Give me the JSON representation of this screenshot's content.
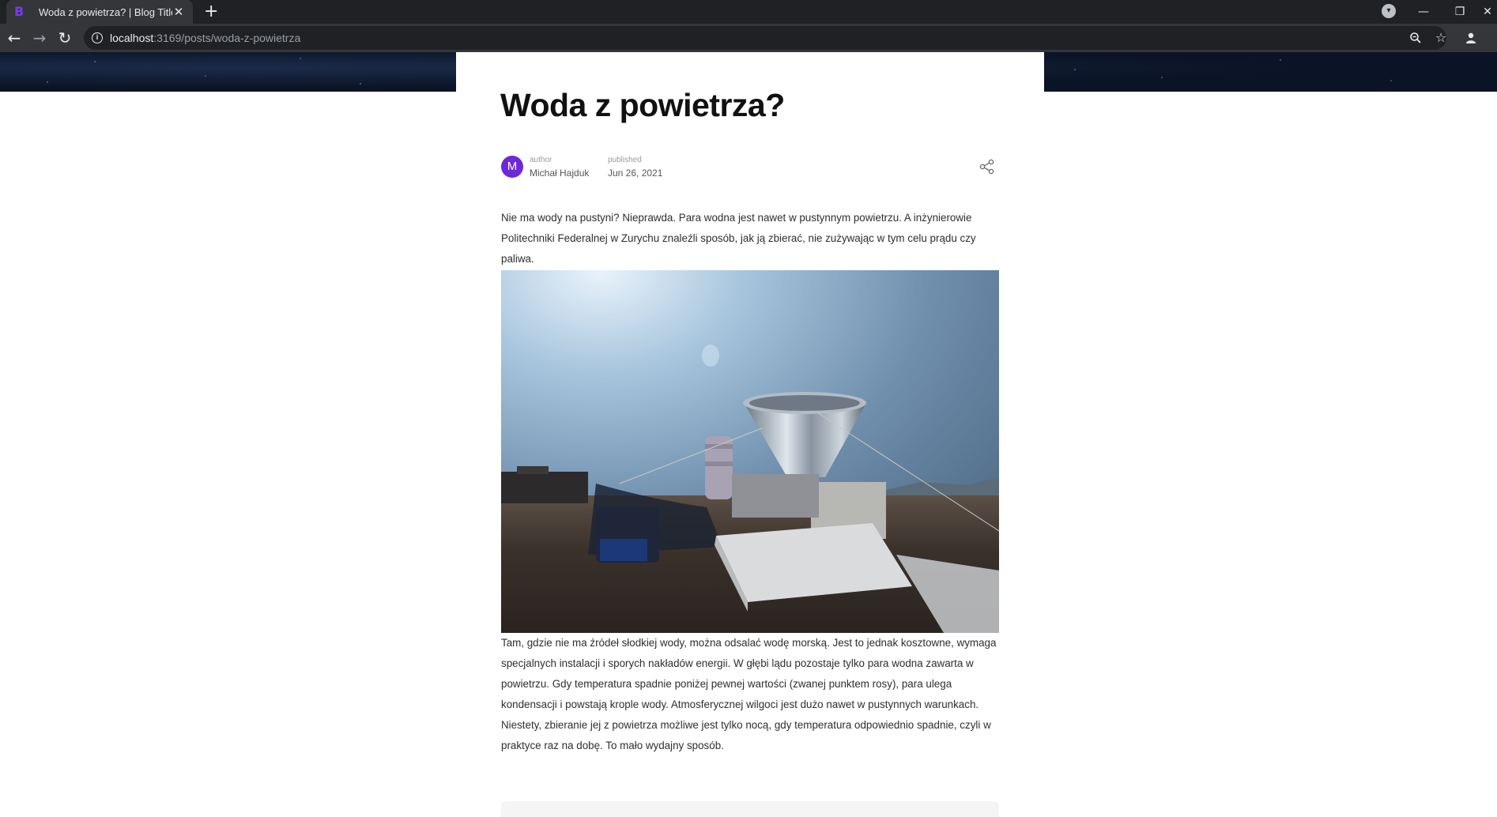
{
  "browser": {
    "tab_title": "Woda z powietrza? | Blog Title",
    "tab_favicon": "B",
    "tab_close": "✕",
    "new_tab": "+",
    "url_host": "localhost",
    "url_path": ":3169/posts/woda-z-powietrza",
    "icons": {
      "back": "back-arrow-icon",
      "forward": "forward-arrow-icon",
      "reload": "reload-icon",
      "info": "info-icon",
      "zoom": "zoom-icon",
      "bookmark": "star-icon",
      "profile": "profile-icon",
      "tab_search": "tab-search-icon"
    }
  },
  "post": {
    "title": "Woda z powietrza?",
    "author_label": "author",
    "author_name": "Michał Hajduk",
    "author_initial": "M",
    "published_label": "published",
    "published_date": "Jun 26, 2021",
    "paragraph_1": "Nie ma wody na pustyni? Nieprawda. Para wodna jest nawet w pustynnym powietrzu. A inżynierowie Politechniki Federalnej w Zurychu znaleźli sposób, jak ją zbierać, nie zużywając w tym celu prądu czy paliwa.",
    "paragraph_2": "Tam, gdzie nie ma źródeł słodkiej wody, można odsalać wodę morską. Jest to jednak kosztowne, wymaga specjalnych instalacji i sporych nakładów energii. W głębi lądu pozostaje tylko para wodna zawarta w powietrzu. Gdy temperatura spadnie poniżej pewnej wartości (zwanej punktem rosy), para ulega kondensacji i powstają krople wody. Atmosferycznej wilgoci jest dużo nawet w pustyn­nych warunkach. Niestety, zbieranie jej z powietrza możliwe jest tylko nocą, gdy temperatura odpowiednio spadnie, czyli w praktyce raz na dobę. To mało wydajny sposób."
  },
  "colors": {
    "accent": "#6d28d9",
    "chrome_dark": "#202124",
    "chrome_toolbar": "#35363a"
  }
}
